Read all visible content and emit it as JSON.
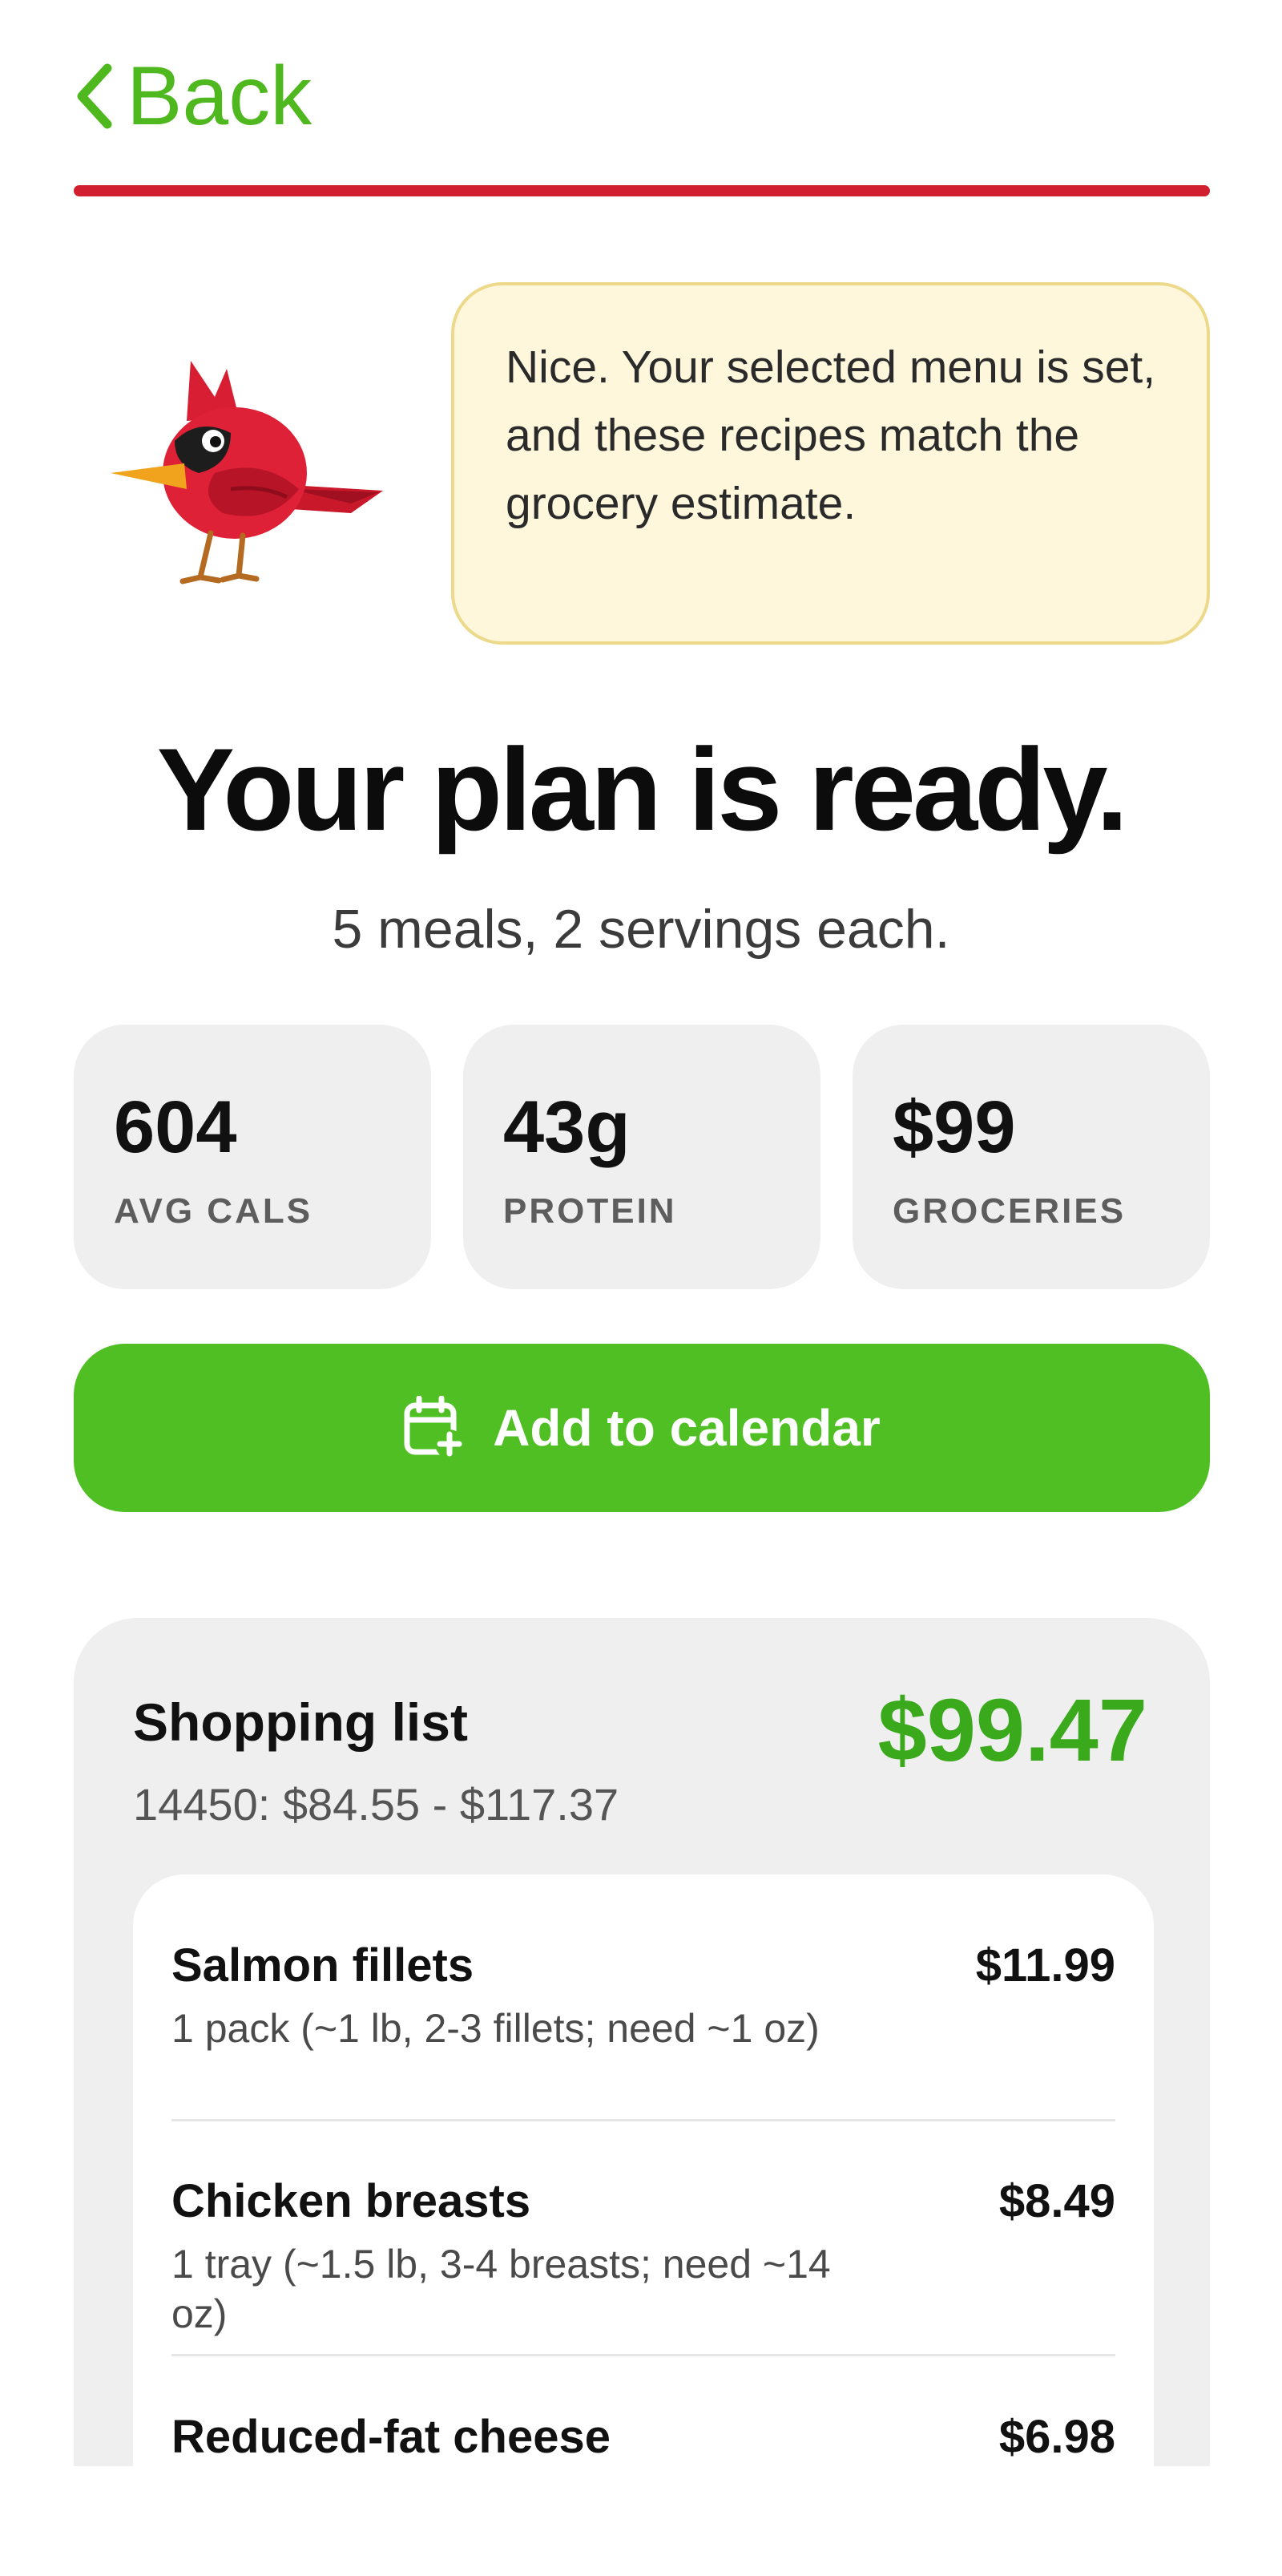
{
  "nav": {
    "back_label": "Back"
  },
  "mascot": {
    "message": "Nice. Your selected menu is set, and these recipes match the grocery estimate."
  },
  "header": {
    "title": "Your plan is ready.",
    "subtitle": "5 meals, 2 servings each."
  },
  "stats": [
    {
      "value": "604",
      "label": "AVG CALS"
    },
    {
      "value": "43g",
      "label": "PROTEIN"
    },
    {
      "value": "$99",
      "label": "GROCERIES"
    }
  ],
  "cta": {
    "label": "Add to calendar",
    "icon": "calendar-add-icon"
  },
  "shopping": {
    "title": "Shopping list",
    "range": "14450: $84.55 - $117.37",
    "total": "$99.47",
    "items": [
      {
        "name": "Salmon fillets",
        "desc": "1 pack (~1 lb, 2-3 fillets; need ~1 oz)",
        "price": "$11.99"
      },
      {
        "name": "Chicken breasts",
        "desc": "1 tray (~1.5 lb, 3-4 breasts; need ~14 oz)",
        "price": "$8.49"
      },
      {
        "name": "Reduced-fat cheese",
        "desc": "",
        "price": "$6.98"
      }
    ]
  },
  "colors": {
    "accent_green": "#4fbf24",
    "total_green": "#3aaa1c",
    "rule_red": "#d21f2f",
    "bubble_bg": "#fff7dc"
  }
}
